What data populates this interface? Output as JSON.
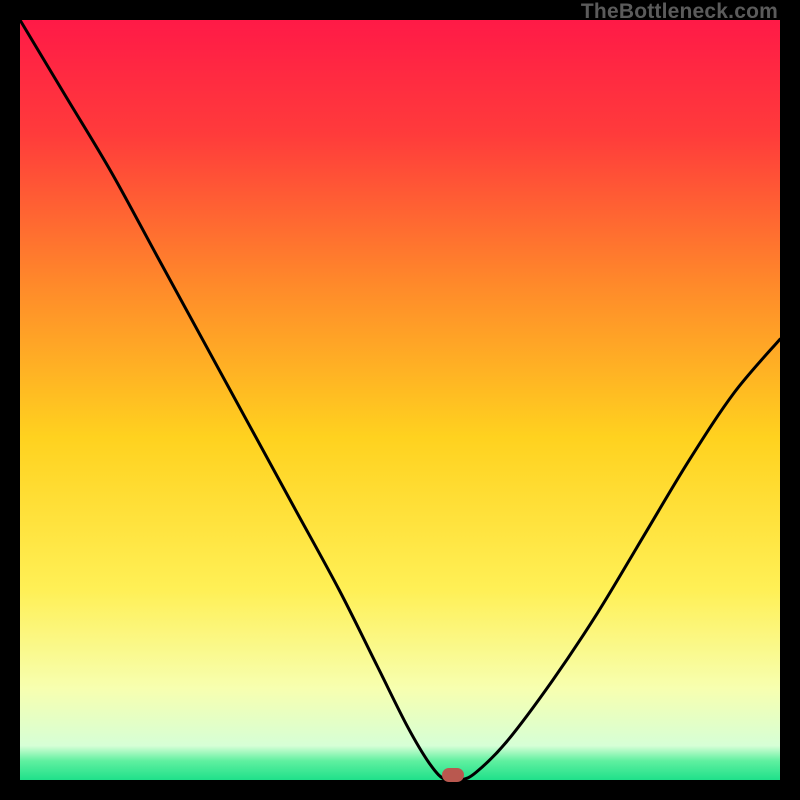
{
  "watermark": {
    "text": "TheBottleneck.com"
  },
  "colors": {
    "curve": "#000000",
    "marker": "#b9584f",
    "gradient_stops": [
      {
        "offset": 0.0,
        "color": "#ff1a47"
      },
      {
        "offset": 0.15,
        "color": "#ff3b3b"
      },
      {
        "offset": 0.35,
        "color": "#ff8a2a"
      },
      {
        "offset": 0.55,
        "color": "#ffd21f"
      },
      {
        "offset": 0.75,
        "color": "#fff056"
      },
      {
        "offset": 0.88,
        "color": "#f7ffb0"
      },
      {
        "offset": 0.955,
        "color": "#d6ffd6"
      },
      {
        "offset": 0.975,
        "color": "#5ff0a0"
      },
      {
        "offset": 1.0,
        "color": "#1fe08a"
      }
    ]
  },
  "chart_data": {
    "type": "line",
    "title": "",
    "xlabel": "",
    "ylabel": "",
    "xlim": [
      0,
      100
    ],
    "ylim": [
      0,
      100
    ],
    "series": [
      {
        "name": "bottleneck-curve",
        "x": [
          0,
          6,
          12,
          18,
          24,
          30,
          36,
          42,
          47,
          51,
          54,
          56,
          58,
          60,
          64,
          70,
          76,
          82,
          88,
          94,
          100
        ],
        "values": [
          100,
          90,
          80,
          69,
          58,
          47,
          36,
          25,
          15,
          7,
          2,
          0,
          0,
          1,
          5,
          13,
          22,
          32,
          42,
          51,
          58
        ]
      }
    ],
    "marker": {
      "x": 57,
      "y": 0.6
    }
  }
}
